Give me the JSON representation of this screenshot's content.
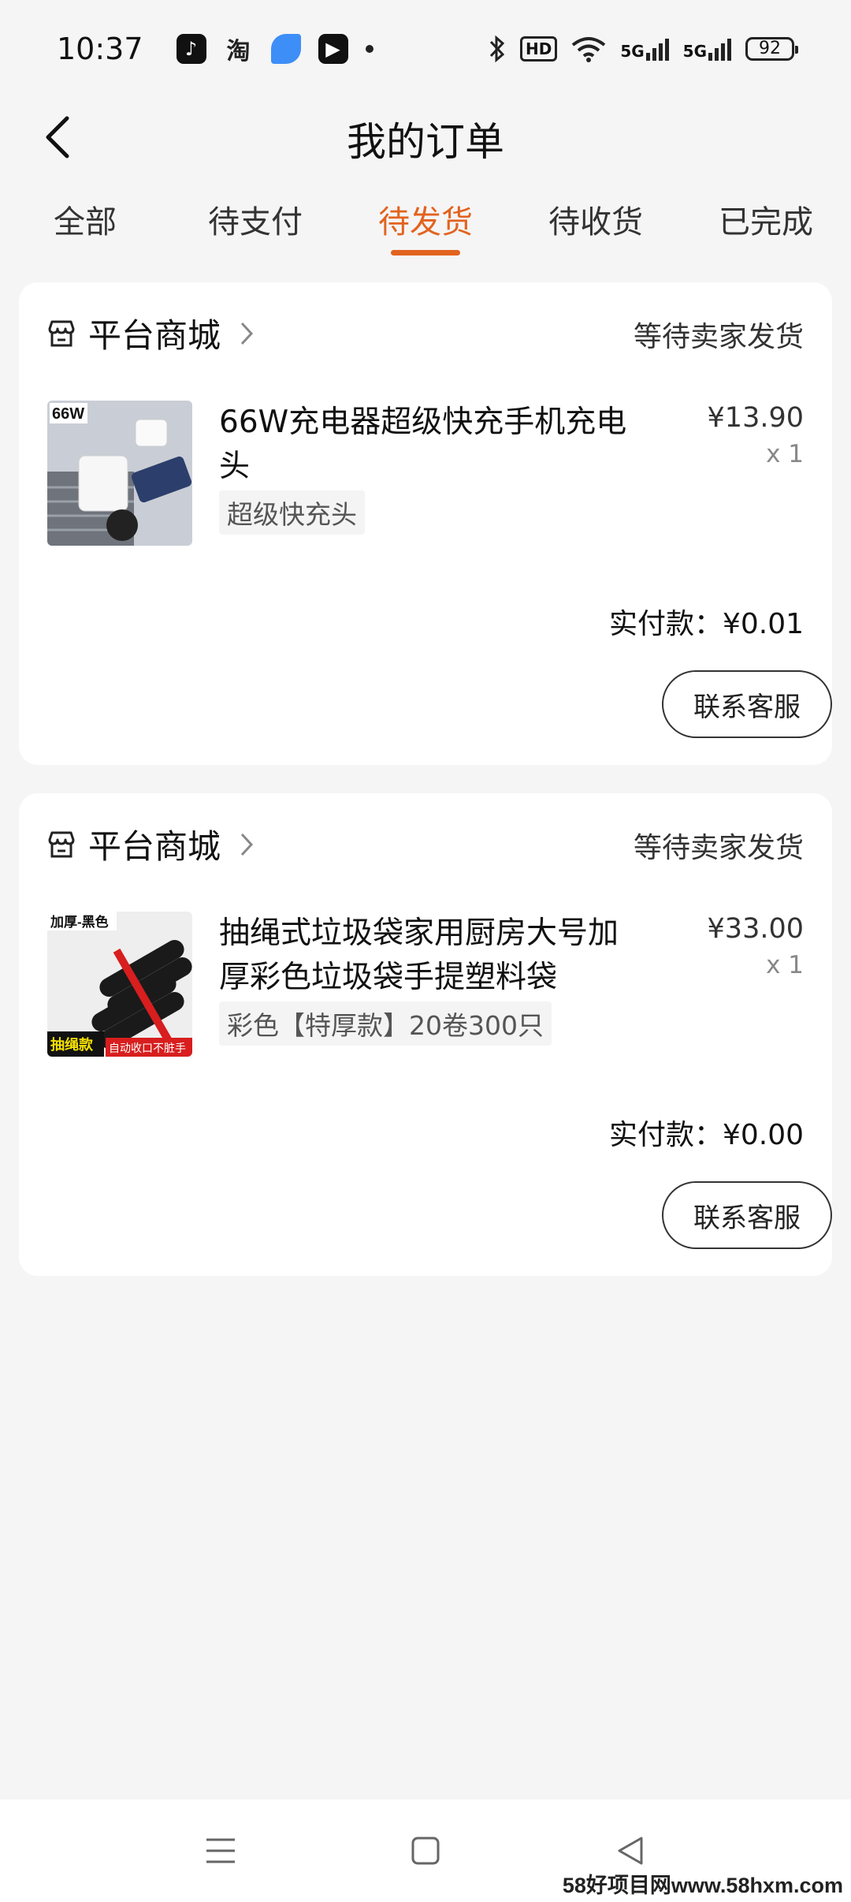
{
  "status_bar": {
    "time": "10:37",
    "app_icons": [
      "tiktok-icon",
      "taobao-icon",
      "blue-app-icon",
      "video-app-icon"
    ],
    "taobao_glyph": "淘",
    "hd_label": "HD",
    "net1": "5G",
    "net2": "5G",
    "battery": "92"
  },
  "header": {
    "title": "我的订单"
  },
  "tabs": [
    {
      "label": "全部",
      "active": false
    },
    {
      "label": "待支付",
      "active": false
    },
    {
      "label": "待发货",
      "active": true
    },
    {
      "label": "待收货",
      "active": false
    },
    {
      "label": "已完成",
      "active": false
    }
  ],
  "orders": [
    {
      "shop": "平台商城",
      "status": "等待卖家发货",
      "product_title": "66W充电器超级快充手机充电头",
      "sku": "超级快充头",
      "price": "¥13.90",
      "qty": "x 1",
      "paid": "实付款：¥0.01",
      "contact": "联系客服",
      "thumb_badge": "66W"
    },
    {
      "shop": "平台商城",
      "status": "等待卖家发货",
      "product_title": "抽绳式垃圾袋家用厨房大号加厚彩色垃圾袋手提塑料袋",
      "sku": "彩色【特厚款】20卷300只",
      "price": "¥33.00",
      "qty": "x 1",
      "paid": "实付款：¥0.00",
      "contact": "联系客服",
      "thumb_badge": "加厚-黑色",
      "thumb_badge2": "抽绳款",
      "thumb_badge3": "自动收口不脏手"
    }
  ],
  "watermark": "58好项目网www.58hxm.com",
  "colors": {
    "accent": "#e2631f",
    "background": "#f5f5f5",
    "card": "#ffffff"
  }
}
